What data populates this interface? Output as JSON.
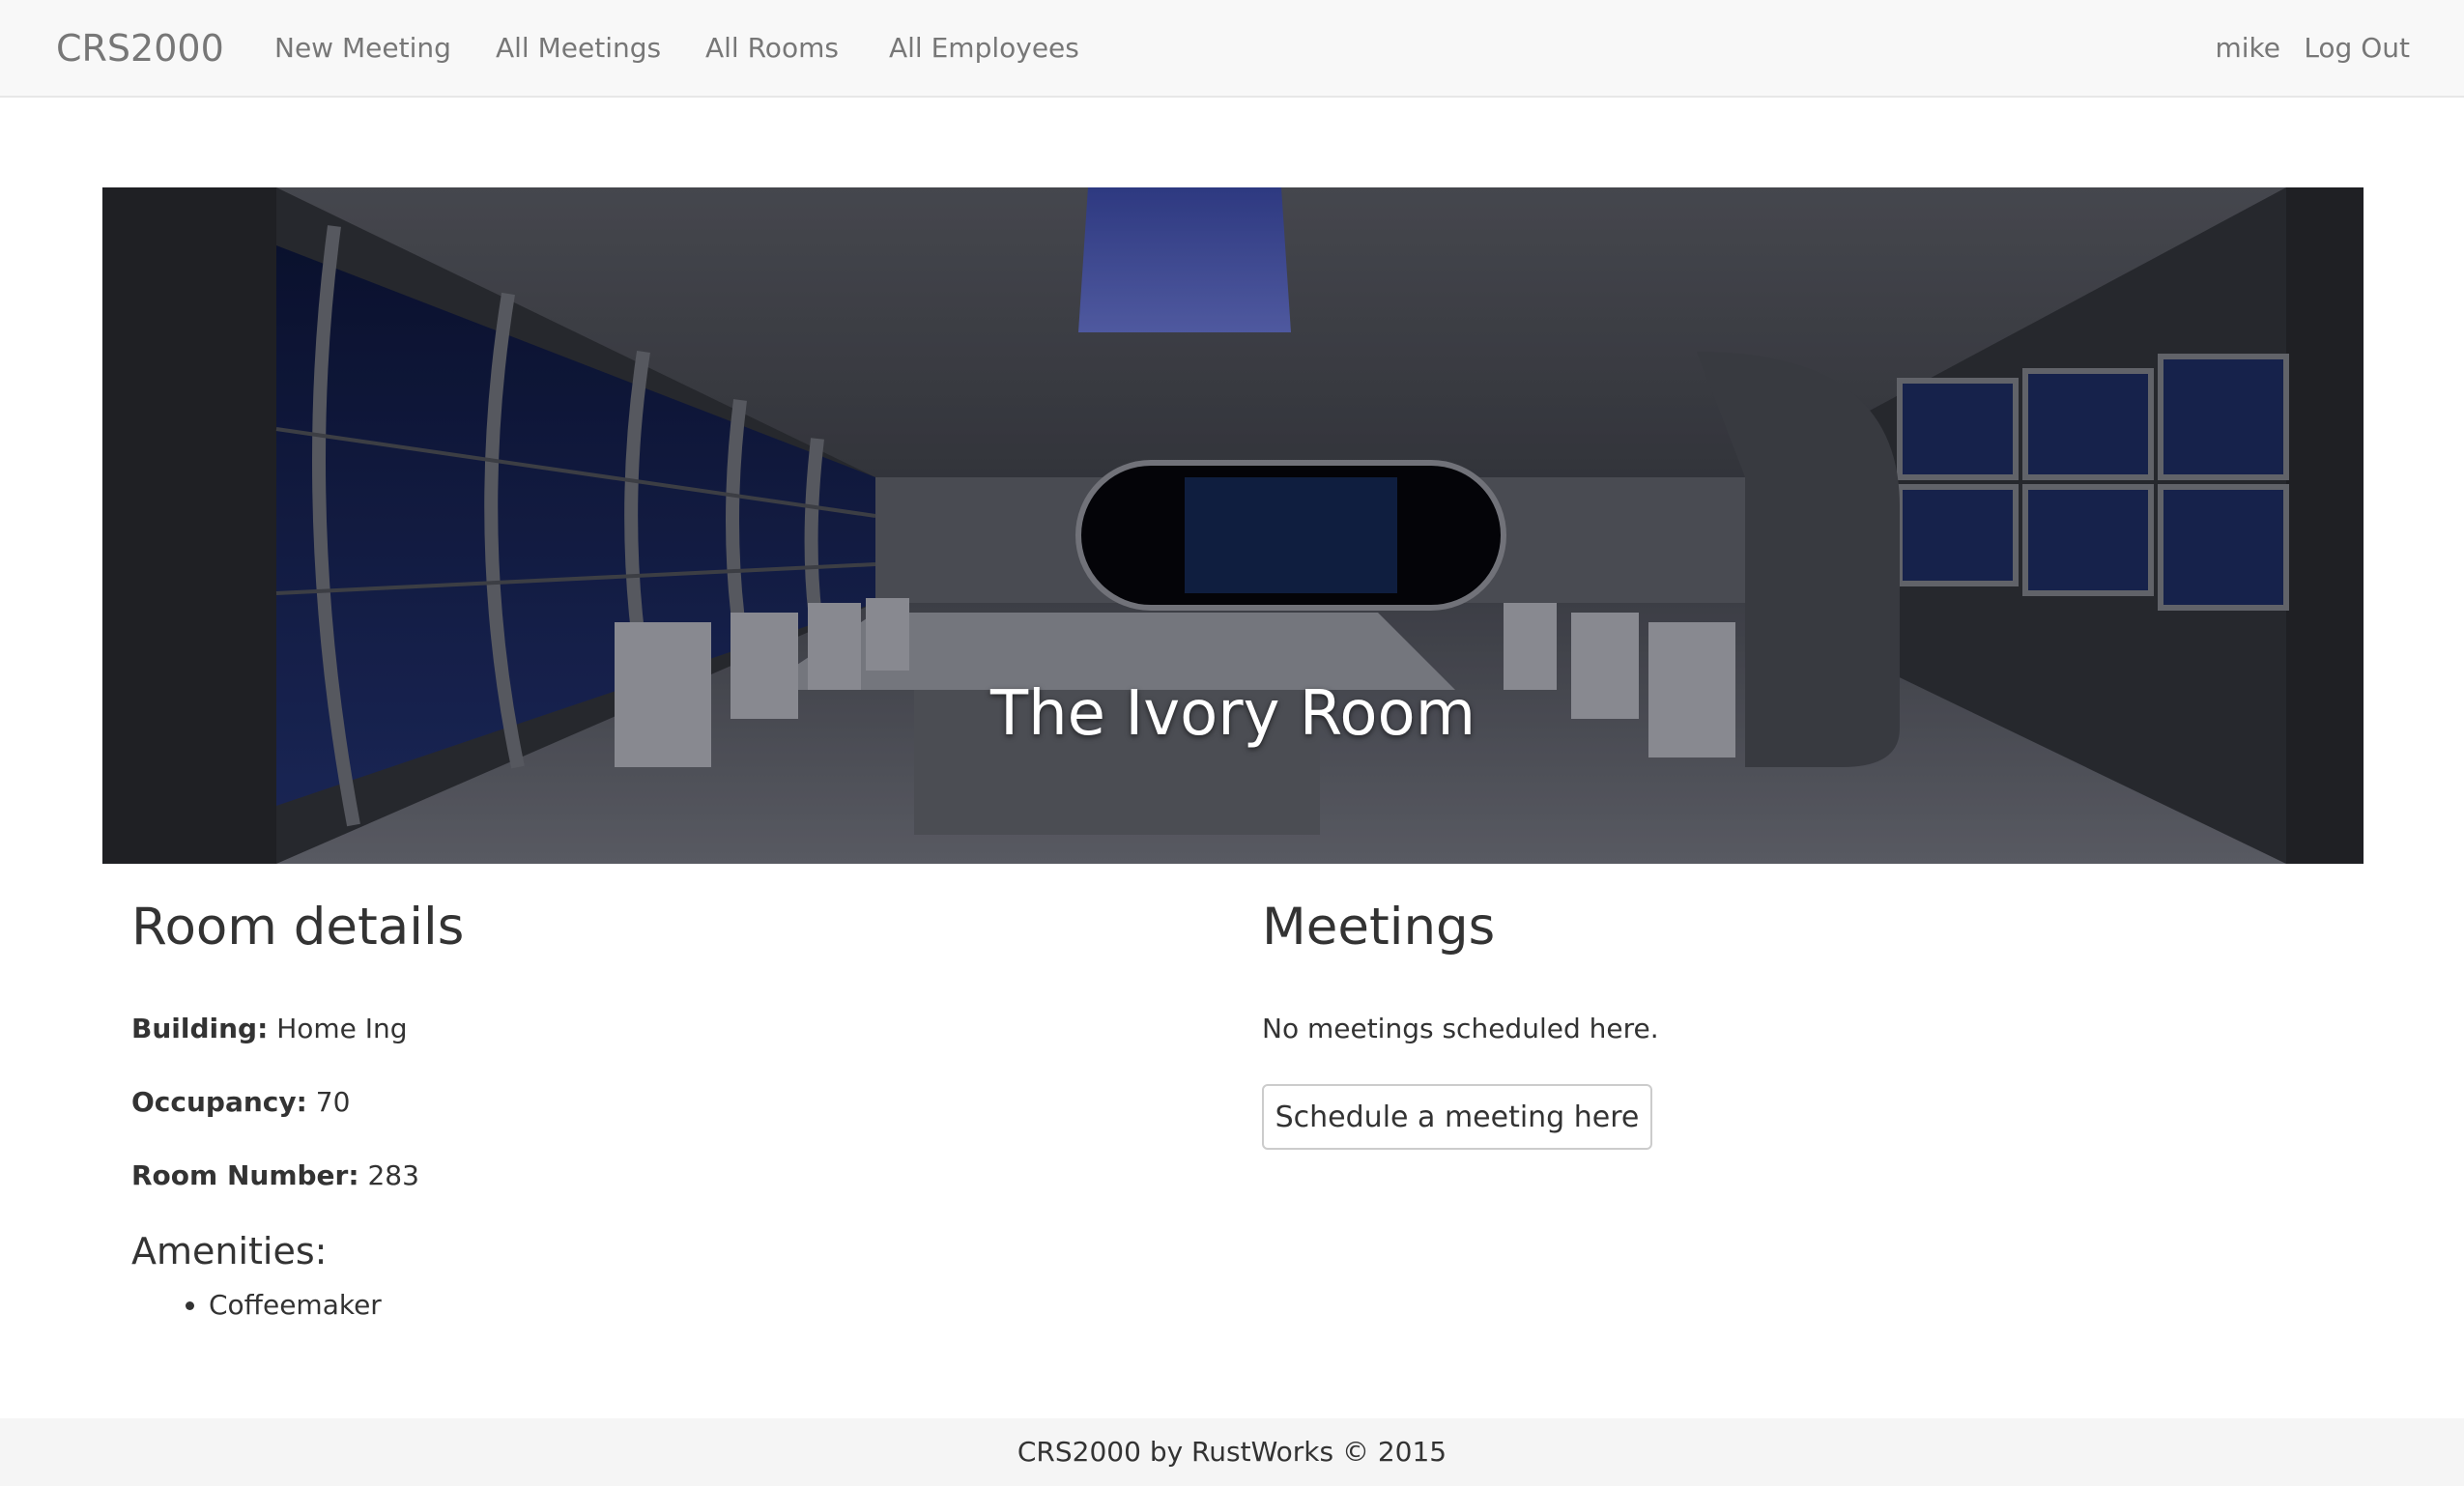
{
  "navbar": {
    "brand": "CRS2000",
    "links": [
      "New Meeting",
      "All Meetings",
      "All Rooms",
      "All Employees"
    ],
    "user": "mike",
    "logout": "Log Out"
  },
  "hero": {
    "title": "The Ivory Room"
  },
  "details": {
    "heading": "Room details",
    "building_label": "Building:",
    "building_value": "Home Ing",
    "occupancy_label": "Occupancy:",
    "occupancy_value": "70",
    "room_number_label": "Room Number:",
    "room_number_value": "283",
    "amenities_heading": "Amenities:",
    "amenities": [
      "Coffeemaker"
    ]
  },
  "meetings": {
    "heading": "Meetings",
    "empty_text": "No meetings scheduled here.",
    "schedule_button": "Schedule a meeting here"
  },
  "footer": {
    "text": "CRS2000 by RustWorks © 2015"
  }
}
